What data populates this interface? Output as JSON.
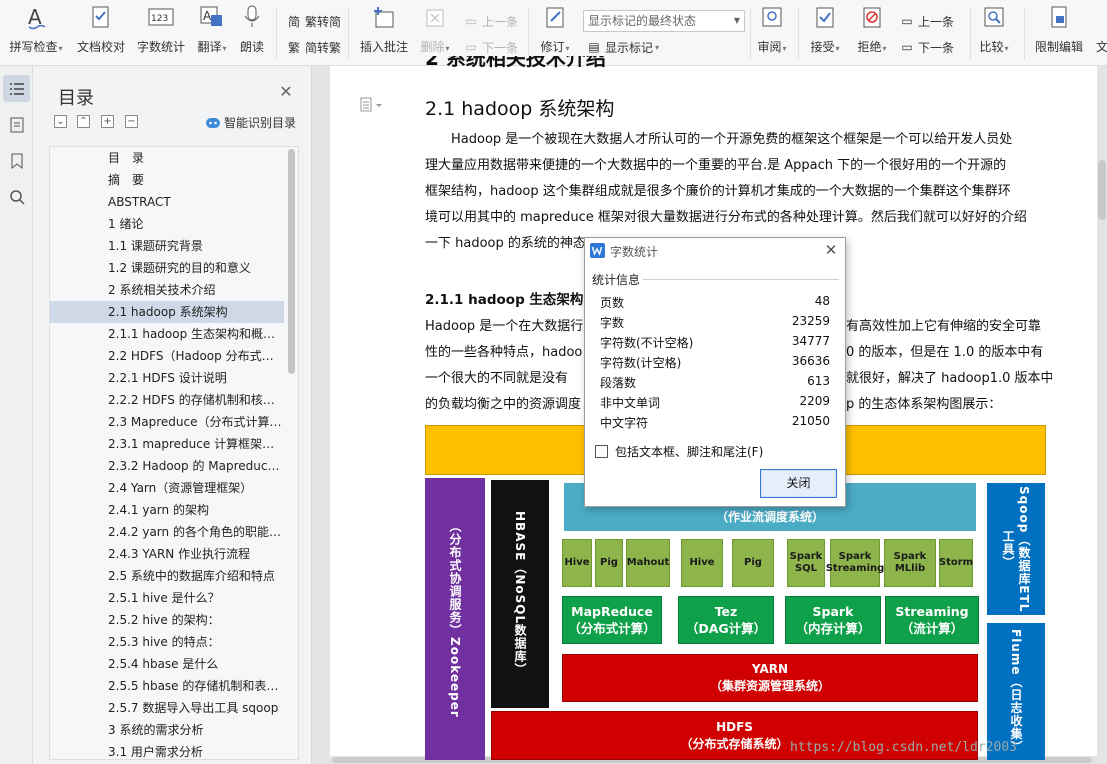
{
  "ribbon": {
    "spell_check": "拼写检查",
    "doc_proofread": "文档校对",
    "word_count": "字数统计",
    "translate": "翻译",
    "read_aloud": "朗读",
    "trad_to_simp": "繁转简",
    "simp_to_trad": "简转繁",
    "insert_comment": "插入批注",
    "delete": "删除",
    "prev_comment": "上一条",
    "next_comment": "下一条",
    "revise": "修订",
    "markup_select": "显示标记的最终状态",
    "show_markup": "显示标记",
    "review": "审阅",
    "accept": "接受",
    "reject": "拒绝",
    "prev_change": "上一条",
    "next_change": "下一条",
    "compare": "比较",
    "restrict_edit": "限制编辑",
    "cut_off": "文"
  },
  "toc": {
    "title": "目录",
    "smart_identify": "智能识别目录",
    "items": [
      {
        "label": "目　录",
        "indent": 1
      },
      {
        "label": "摘　要",
        "indent": 1
      },
      {
        "label": "ABSTRACT",
        "indent": 1
      },
      {
        "label": "1  绪论",
        "indent": 1
      },
      {
        "label": "1.1 课题研究背景",
        "indent": 1
      },
      {
        "label": "1.2 课题研究的目的和意义",
        "indent": 1
      },
      {
        "label": "2  系统相关技术介绍",
        "indent": 1
      },
      {
        "label": "2.1 hadoop 系统架构",
        "indent": 1,
        "selected": true
      },
      {
        "label": "2.1.1 hadoop  生态架构和概念介绍",
        "indent": 1
      },
      {
        "label": "2.2 HDFS（Hadoop 分布式文件系统）",
        "indent": 1
      },
      {
        "label": "2.2.1 HDFS  设计说明",
        "indent": 1
      },
      {
        "label": "2.2.2 HDFS 的存储机制和核心功能",
        "indent": 1
      },
      {
        "label": "2.3 Mapreduce（分布式计算框架）",
        "indent": 1
      },
      {
        "label": "2.3.1 mapreduce 计算框架概述",
        "indent": 1
      },
      {
        "label": "2.3.2 Hadoop 的 Mapreduce 工作流程",
        "indent": 1
      },
      {
        "label": "2.4 Yarn（资源管理框架）",
        "indent": 1
      },
      {
        "label": "2.4.1 yarn 的架构",
        "indent": 1
      },
      {
        "label": "2.4.2 yarn 的各个角色的职能说明",
        "indent": 1
      },
      {
        "label": "2.4.3 YARN  作业执行流程",
        "indent": 1
      },
      {
        "label": "2.5  系统中的数据库介绍和特点",
        "indent": 1
      },
      {
        "label": "2.5.1 hive 是什么？",
        "indent": 1
      },
      {
        "label": "2.5.2 hive 的架构：",
        "indent": 1
      },
      {
        "label": "2.5.3 hive 的特点：",
        "indent": 1
      },
      {
        "label": "2.5.4 hbase 是什么",
        "indent": 1
      },
      {
        "label": "2.5.5 hbase 的存储机制和表结构",
        "indent": 1
      },
      {
        "label": "2.5.7  数据导入导出工具 sqoop",
        "indent": 1
      },
      {
        "label": "3  系统的需求分析",
        "indent": 1
      },
      {
        "label": "3.1  用户需求分析",
        "indent": 1
      }
    ]
  },
  "doc": {
    "heading_top": "2  系统相关技术介绍",
    "heading": "2.1  hadoop 系统架构",
    "para1": [
      "　　Hadoop 是一个被现在大数据人才所认可的一个开源免费的框架这个框架是一个可以给开发人员处",
      "理大量应用数据带来便捷的一个大数据中的一个重要的平台.是 Appach 下的一个很好用的一个开源的",
      "框架结构，hadoop 这个集群组成就是很多个廉价的计算机才集成的一个大数据的一个集群这个集群环",
      "境可以用其中的 mapreduce 框架对很大量数据进行分布式的各种处理计算。然后我们就可以好好的介绍",
      "一下 hadoop 的系统的神态"
    ],
    "subheading": "2.1.1  hadoop  生态架构",
    "para2": [
      "Hadoop 是一个在大数据行",
      "性的一些各种特点，hadoo",
      "一个很大的不同就是没有",
      "的负载均衡之中的资源调度"
    ],
    "para2_right": [
      "有高效性加上它有伸缩的安全可靠",
      "0 的版本，但是在 1.0 的版本中有",
      "就很好，解决了 hadoop1.0 版本中",
      "p 的生态体系架构图展示："
    ],
    "watermark": "https://blog.csdn.net/ldr2003"
  },
  "diagram": {
    "zookeeper": "（分布式协调服务）Zookeeper",
    "hbase": "HBASE（NoSQL数据库）",
    "workflow": "（作业流调度系统）",
    "sqoop": "Sqoop（数据库ETL工具）",
    "flume": "Flume（日志收集）",
    "small": [
      "Hive",
      "Pig",
      "Mahout",
      "Hive",
      "Pig",
      "Spark SQL",
      "Spark Streaming",
      "Spark MLlib",
      "Storm"
    ],
    "big": [
      {
        "name": "MapReduce",
        "sub": "（分布式计算）"
      },
      {
        "name": "Tez",
        "sub": "（DAG计算）"
      },
      {
        "name": "Spark",
        "sub": "（内存计算）"
      },
      {
        "name": "Streaming",
        "sub": "（流计算）"
      }
    ],
    "yarn": {
      "name": "YARN",
      "sub": "（集群资源管理系统）"
    },
    "hdfs": {
      "name": "HDFS",
      "sub": "（分布式存储系统）"
    },
    "colors": {
      "top": "#ffc000",
      "zookeeper": "#7030a0",
      "hbase": "#111111",
      "workflow": "#4bacc6",
      "sqoop": "#0070c0",
      "green_small": "#8db54b",
      "green_big": "#0fa04a",
      "red": "#d10000"
    }
  },
  "dialog": {
    "title": "字数统计",
    "group": "统计信息",
    "stats": [
      {
        "label": "页数",
        "value": "48"
      },
      {
        "label": "字数",
        "value": "23259"
      },
      {
        "label": "字符数(不计空格)",
        "value": "34777"
      },
      {
        "label": "字符数(计空格)",
        "value": "36636"
      },
      {
        "label": "段落数",
        "value": "613"
      },
      {
        "label": "非中文单词",
        "value": "2209"
      },
      {
        "label": "中文字符",
        "value": "21050"
      }
    ],
    "checkbox_label": "包括文本框、脚注和尾注(F)",
    "close_label": "关闭"
  }
}
